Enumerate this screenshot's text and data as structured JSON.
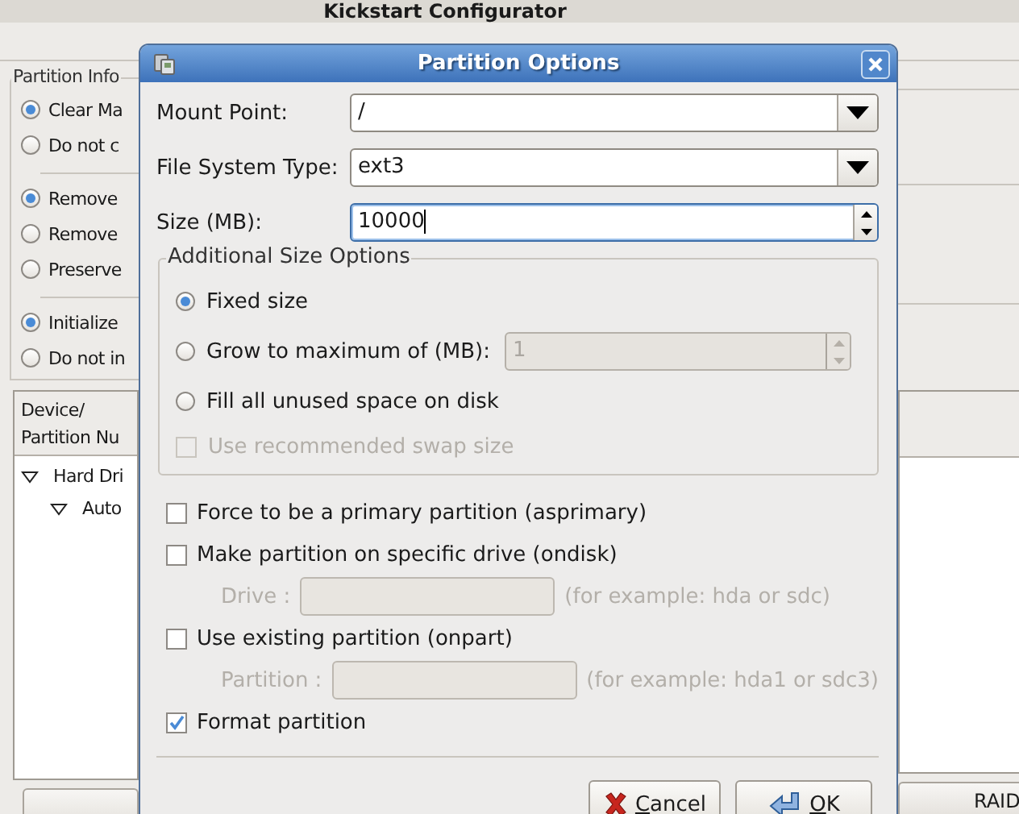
{
  "main_window": {
    "title": "Kickstart Configurator",
    "partition_info": {
      "title": "Partition Info",
      "groups": [
        [
          {
            "label": "Clear Ma",
            "selected": true
          },
          {
            "label": "Do not c",
            "selected": false
          }
        ],
        [
          {
            "label": "Remove",
            "selected": true
          },
          {
            "label": "Remove",
            "selected": false
          },
          {
            "label": "Preserve",
            "selected": false
          }
        ],
        [
          {
            "label": "Initialize",
            "selected": true
          },
          {
            "label": "Do not in",
            "selected": false
          }
        ]
      ]
    },
    "partition_list": {
      "columns": [
        "Device/\nPartition Nu"
      ],
      "tree": [
        {
          "label": "Hard Dri",
          "expanded": true,
          "children": [
            {
              "label": "Auto",
              "expanded": true
            }
          ]
        }
      ]
    },
    "buttons": [
      "RAID"
    ]
  },
  "dialog": {
    "title": "Partition Options",
    "fields": [
      {
        "kind": "combo",
        "label": "Mount Point:",
        "value": "/",
        "focused": false
      },
      {
        "kind": "combo",
        "label": "File System Type:",
        "value": "ext3",
        "focused": false
      },
      {
        "kind": "spin",
        "label": "Size (MB):",
        "value": "10000",
        "focused": true
      }
    ],
    "size_options": {
      "title": "Additional Size Options",
      "choices": [
        {
          "label": "Fixed size",
          "selected": true
        },
        {
          "label": "Grow to maximum of (MB):",
          "selected": false,
          "spin": {
            "value": "1",
            "disabled": true
          }
        },
        {
          "label": "Fill all unused space on disk",
          "selected": false
        }
      ],
      "swap": {
        "label": "Use recommended swap size",
        "checked": false,
        "disabled": true
      }
    },
    "options": [
      {
        "label": "Force to be a primary partition (asprimary)",
        "checked": false
      },
      {
        "label": "Make partition on specific drive (ondisk)",
        "checked": false,
        "sub": {
          "label": "Drive :",
          "hint": "(for example: hda or sdc)",
          "disabled": true
        }
      },
      {
        "label": "Use existing partition (onpart)",
        "checked": false,
        "sub": {
          "label": "Partition :",
          "hint": "(for example: hda1 or sdc3)",
          "disabled": true
        }
      },
      {
        "label": "Format partition",
        "checked": true
      }
    ],
    "buttons": [
      {
        "kind": "cancel",
        "label": "Cancel"
      },
      {
        "kind": "ok",
        "label": "OK"
      }
    ]
  }
}
